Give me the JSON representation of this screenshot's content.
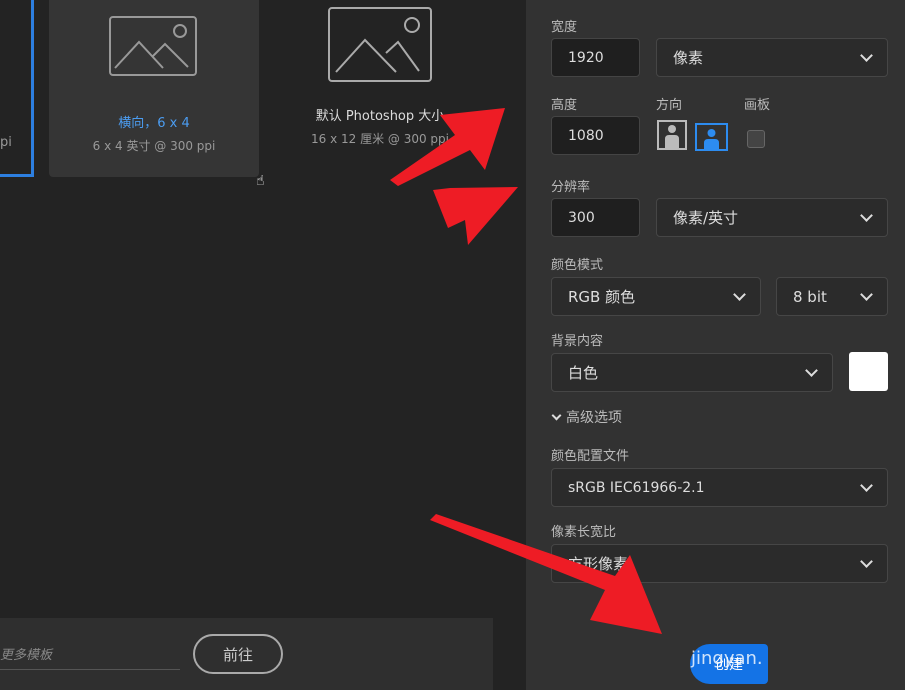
{
  "presets": [
    {
      "partial_text": "pi"
    },
    {
      "title": "横向，6 x 4",
      "subtitle": "6 x 4 英寸 @ 300 ppi",
      "selected_hover": true
    },
    {
      "title": "默认 Photoshop 大小",
      "subtitle": "16 x 12 厘米 @ 300 ppi"
    }
  ],
  "search": {
    "placeholder": "更多模板",
    "go_label": "前往"
  },
  "settings": {
    "width_label": "宽度",
    "width_value": "1920",
    "width_unit": "像素",
    "height_label": "高度",
    "height_value": "1080",
    "orientation_label": "方向",
    "orientation_selected": "landscape",
    "artboard_label": "画板",
    "artboard_checked": false,
    "resolution_label": "分辨率",
    "resolution_value": "300",
    "resolution_unit": "像素/英寸",
    "color_mode_label": "颜色模式",
    "color_mode": "RGB 颜色",
    "bit_depth": "8 bit",
    "background_label": "背景内容",
    "background": "白色",
    "background_swatch": "#ffffff",
    "advanced_label": "高级选项",
    "profile_label": "颜色配置文件",
    "profile": "sRGB IEC61966-2.1",
    "pixel_aspect_label": "像素长宽比",
    "pixel_aspect": "方形像素"
  },
  "create_label": "创建",
  "watermark": "jingyan.",
  "colors": {
    "accent": "#1473e6",
    "annotation": "#ee1c25"
  }
}
